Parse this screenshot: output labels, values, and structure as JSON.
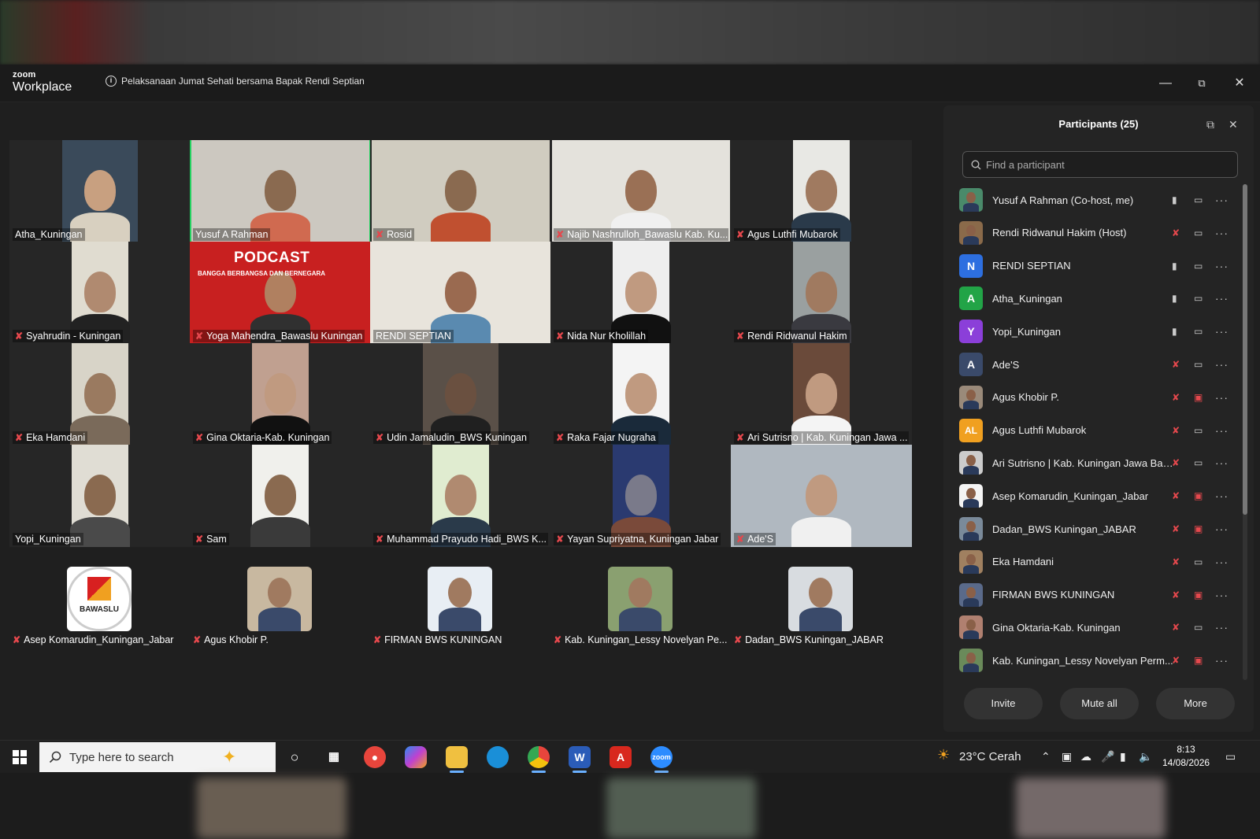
{
  "window": {
    "app_logo_top": "zoom",
    "app_logo_bottom": "Workplace",
    "meeting_title": "Pelaksanaan Jumat Sehati bersama Bapak Rendi Septian"
  },
  "video_tiles": [
    {
      "name": "Atha_Kuningan",
      "muted": false
    },
    {
      "name": "Yusuf A Rahman",
      "muted": false,
      "active": true
    },
    {
      "name": "Rosid",
      "muted": true
    },
    {
      "name": "Najib Nashrulloh_Bawaslu Kab. Ku...",
      "muted": true
    },
    {
      "name": "Agus Luthfi Mubarok",
      "muted": true
    },
    {
      "name": "Syahrudin - Kuningan",
      "muted": true
    },
    {
      "name": "Yoga Mahendra_Bawaslu Kuningan",
      "muted": true,
      "overlay_title": "PODCAST",
      "overlay_sub": "BANGGA BERBANGSA DAN BERNEGARA"
    },
    {
      "name": "RENDI SEPTIAN",
      "muted": false
    },
    {
      "name": "Nida Nur Kholillah",
      "muted": true
    },
    {
      "name": "Rendi Ridwanul Hakim",
      "muted": true
    },
    {
      "name": "Eka Hamdani",
      "muted": true
    },
    {
      "name": "Gina Oktaria-Kab. Kuningan",
      "muted": true
    },
    {
      "name": "Udin Jamaludin_BWS Kuningan",
      "muted": true
    },
    {
      "name": "Raka Fajar Nugraha",
      "muted": true
    },
    {
      "name": "Ari Sutrisno | Kab. Kuningan Jawa ...",
      "muted": true
    },
    {
      "name": "Yopi_Kuningan",
      "muted": false
    },
    {
      "name": "Sam",
      "muted": true
    },
    {
      "name": "Muhammad Prayudo Hadi_BWS K...",
      "muted": true
    },
    {
      "name": "Yayan Supriyatna, Kuningan Jabar",
      "muted": true
    },
    {
      "name": "Ade'S",
      "muted": true
    }
  ],
  "avatar_tiles": [
    {
      "name": "Asep Komarudin_Kuningan_Jabar",
      "logo_text": "BAWASLU"
    },
    {
      "name": "Agus Khobir P."
    },
    {
      "name": "FIRMAN BWS KUNINGAN"
    },
    {
      "name": "Kab. Kuningan_Lessy Novelyan Pe..."
    },
    {
      "name": "Dadan_BWS Kuningan_JABAR"
    }
  ],
  "participants_panel": {
    "title": "Participants (25)",
    "search_placeholder": "Find a participant",
    "buttons": {
      "invite": "Invite",
      "mute_all": "Mute all",
      "more": "More"
    },
    "list": [
      {
        "name": "Yusuf A Rahman (Co-host, me)",
        "initial": "",
        "color": "#4a8a6a",
        "mic": "on",
        "cam": "on"
      },
      {
        "name": "Rendi Ridwanul Hakim (Host)",
        "initial": "",
        "color": "#8a6a4a",
        "mic": "off",
        "cam": "on"
      },
      {
        "name": "RENDI SEPTIAN",
        "initial": "N",
        "color": "#2d6fe0",
        "mic": "on",
        "cam": "on"
      },
      {
        "name": "Atha_Kuningan",
        "initial": "A",
        "color": "#22a447",
        "mic": "on",
        "cam": "on"
      },
      {
        "name": "Yopi_Kuningan",
        "initial": "Y",
        "color": "#8b3fd9",
        "mic": "on",
        "cam": "on"
      },
      {
        "name": "Ade'S",
        "initial": "A",
        "color": "#3a4a6a",
        "mic": "off",
        "cam": "on"
      },
      {
        "name": "Agus Khobir P.",
        "initial": "",
        "color": "#9a8a7a",
        "mic": "off",
        "cam": "off"
      },
      {
        "name": "Agus Luthfi Mubarok",
        "initial": "AL",
        "color": "#f0a020",
        "mic": "off",
        "cam": "on"
      },
      {
        "name": "Ari Sutrisno | Kab. Kuningan Jawa Bar...",
        "initial": "",
        "color": "#ccc",
        "mic": "off",
        "cam": "on"
      },
      {
        "name": "Asep Komarudin_Kuningan_Jabar",
        "initial": "",
        "color": "#f4f4f4",
        "mic": "off",
        "cam": "off"
      },
      {
        "name": "Dadan_BWS Kuningan_JABAR",
        "initial": "",
        "color": "#7a8a9a",
        "mic": "off",
        "cam": "off"
      },
      {
        "name": "Eka Hamdani",
        "initial": "",
        "color": "#a08060",
        "mic": "off",
        "cam": "on"
      },
      {
        "name": "FIRMAN BWS KUNINGAN",
        "initial": "",
        "color": "#5a6a8a",
        "mic": "off",
        "cam": "off"
      },
      {
        "name": "Gina Oktaria-Kab. Kuningan",
        "initial": "",
        "color": "#b08070",
        "mic": "off",
        "cam": "on"
      },
      {
        "name": "Kab. Kuningan_Lessy Novelyan Perm...",
        "initial": "",
        "color": "#6a8a5a",
        "mic": "off",
        "cam": "off"
      }
    ]
  },
  "taskbar": {
    "search_placeholder": "Type here to search",
    "weather": "23°C  Cerah",
    "time": "8:13",
    "date": "14/08/2026"
  }
}
